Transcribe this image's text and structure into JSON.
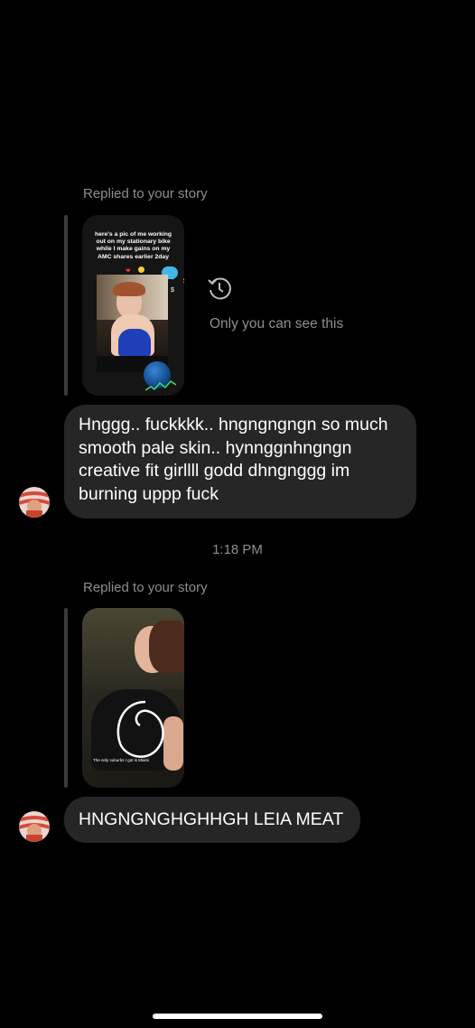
{
  "thread": {
    "messages": [
      {
        "reply_label": "Replied to your story",
        "story": {
          "caption": "here's a pic of me working out on my stationary bike while I make gains on my AMC shares earlier 2day",
          "sticker_text": "$"
        },
        "privacy_note": "Only you can see this",
        "text": "Hnggg.. fuckkkk.. hngngngngn so much smooth pale skin.. hynnggnhngngn creative fit girllll godd dhngnggg im burning uppp fuck"
      },
      {
        "reply_label": "Replied to your story",
        "story": {
          "caption": "The only suburbs I got is Miami"
        },
        "text": "HNGNGNGHGHHGH LEIA MEAT"
      }
    ],
    "timestamp": "1:18 PM"
  },
  "icons": {
    "privacy": "history-clock-icon",
    "avatar": "user-avatar"
  },
  "colors": {
    "background": "#000000",
    "bubble": "#262626",
    "muted_text": "#8e8e8e"
  }
}
